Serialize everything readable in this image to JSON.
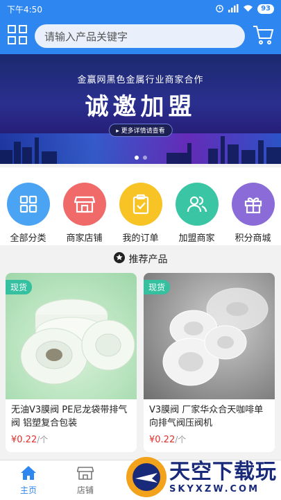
{
  "status_bar": {
    "time": "下午4:50",
    "battery": "93"
  },
  "header": {
    "search_placeholder": "请输入产品关键字"
  },
  "banner": {
    "subtitle": "金赢网黑色金属行业商家合作",
    "title": "诚邀加盟",
    "button_label": "▸ 更多详情请查看"
  },
  "categories": [
    {
      "label": "全部分类",
      "color": "#4aa3f3",
      "icon": "grid-icon"
    },
    {
      "label": "商家店铺",
      "color": "#f06a6a",
      "icon": "store-icon"
    },
    {
      "label": "我的订单",
      "color": "#f7c325",
      "icon": "clipboard-icon"
    },
    {
      "label": "加盟商家",
      "color": "#3ac5a4",
      "icon": "users-icon"
    },
    {
      "label": "积分商城",
      "color": "#8a6bd8",
      "icon": "gift-icon"
    }
  ],
  "recommend": {
    "title": "推荐产品"
  },
  "products": [
    {
      "badge": "现货",
      "title": "无油V3膜阀 PE尼龙袋带排气阀 铝塑复合包装",
      "price": "¥0.22",
      "unit": "/个"
    },
    {
      "badge": "现货",
      "title": "V3膜阀 厂家华众合天咖啡单向排气阀压阀机",
      "price": "¥0.22",
      "unit": "/个"
    }
  ],
  "bottom_nav": [
    {
      "label": "主页",
      "icon": "home-icon",
      "active": true
    },
    {
      "label": "店铺",
      "icon": "shop-icon",
      "active": false
    }
  ],
  "watermark": {
    "main": "天空下载玩",
    "url": "SKYXZW.COM"
  }
}
